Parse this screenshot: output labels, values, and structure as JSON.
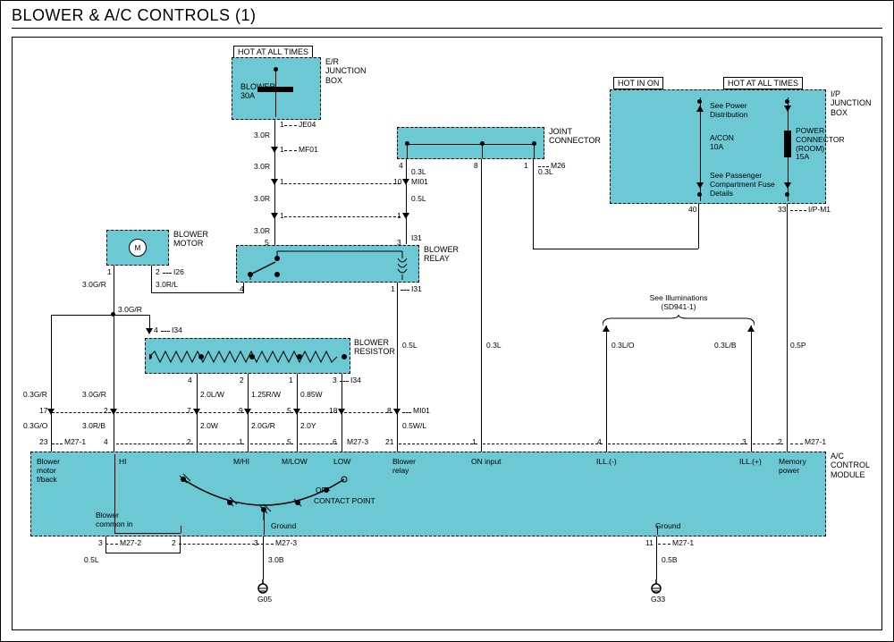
{
  "title": "BLOWER & A/C CONTROLS (1)",
  "states": {
    "hot_all_times": "HOT AT ALL TIMES",
    "hot_in_on": "HOT IN ON"
  },
  "boxes": {
    "er_junction": "E/R\nJUNCTION\nBOX",
    "er_fuse": "BLOWER\n30A",
    "ip_junction": "I/P\nJUNCTION\nBOX",
    "ip_acon": "A/CON\n10A",
    "ip_power_conn": "POWER\nCONNECTOR\n(ROOM)\n15A",
    "see_power_dist": "See Power\nDistribution",
    "see_passenger": "See Passenger\nCompartment Fuse\nDetails",
    "blower_motor": "BLOWER\nMOTOR",
    "joint_connector": "JOINT\nCONNECTOR",
    "blower_relay": "BLOWER\nRELAY",
    "blower_resistor": "BLOWER\nRESISTOR",
    "ac_control_module": "A/C\nCONTROL\nMODULE"
  },
  "module_labels": {
    "blower_fback": "Blower\nmotor\nf/back",
    "hi": "HI",
    "mhi": "M/HI",
    "mlow": "M/LOW",
    "low": "LOW",
    "off": "OFF",
    "contact_point": "CONTACT POINT",
    "blower_relay": "Blower\nrelay",
    "on_input": "ON input",
    "ill_minus": "ILL.(-)",
    "ill_plus": "ILL.(+)",
    "memory_power": "Memory\npower",
    "blower_common_in": "Blower\ncommon in",
    "ground": "Ground",
    "ground2": "Ground"
  },
  "refs": {
    "illuminations": "See Illuminations\n(SD941-1)"
  },
  "connectors": {
    "JE04": "JE04",
    "MF01": "MF01",
    "MI01": "MI01",
    "I31": "I31",
    "I26": "I26",
    "I34": "I34",
    "M26": "M26",
    "M27_1": "M27-1",
    "M27_2": "M27-2",
    "M27_3": "M27-3",
    "IP_M1": "I/P-M1"
  },
  "pins": {
    "p1": "1",
    "p2": "2",
    "p3": "3",
    "p4": "4",
    "p5": "5",
    "p6": "6",
    "p7": "7",
    "p8": "8",
    "p9": "9",
    "p10": "10",
    "p11": "11",
    "p17": "17",
    "p18": "18",
    "p21": "21",
    "p23": "23",
    "p33": "33",
    "p40": "40"
  },
  "wires": {
    "w30R": "3.0R",
    "w03L": "0.3L",
    "w05L": "0.5L",
    "w30GR": "3.0G/R",
    "w30RL": "3.0R/L",
    "w03GR": "0.3G/R",
    "w03GO": "0.3G/O",
    "w30RB": "3.0R/B",
    "w20LW": "2.0L/W",
    "w125RW": "1.25R/W",
    "w085W": "0.85W",
    "w20W": "2.0W",
    "w20GR": "2.0G/R",
    "w20Y": "2.0Y",
    "w05WL": "0.5W/L",
    "w03LO": "0.3L/O",
    "w03LB": "0.3L/B",
    "w05P": "0.5P",
    "w30B": "3.0B",
    "w05B": "0.5B"
  },
  "grounds": {
    "G05": "G05",
    "G33": "G33"
  },
  "motor_label": "M"
}
